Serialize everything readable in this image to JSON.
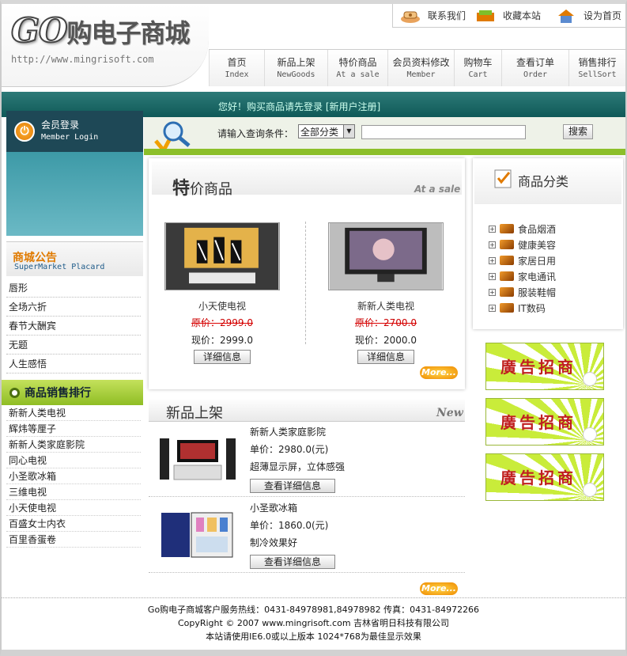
{
  "brand": {
    "logo_prefix": "GO",
    "logo_text": "购电子商城",
    "url": "http://www.mingrisoft.com"
  },
  "top_links": [
    {
      "label": "联系我们",
      "icon": "phone-icon"
    },
    {
      "label": "收藏本站",
      "icon": "bookmark-icon"
    },
    {
      "label": "设为首页",
      "icon": "home-icon"
    }
  ],
  "nav": [
    {
      "cn": "首页",
      "en": "Index"
    },
    {
      "cn": "新品上架",
      "en": "NewGoods"
    },
    {
      "cn": "特价商品",
      "en": "At a sale"
    },
    {
      "cn": "会员资料修改",
      "en": "Member"
    },
    {
      "cn": "购物车",
      "en": "Cart"
    },
    {
      "cn": "查看订单",
      "en": "Order"
    },
    {
      "cn": "销售排行",
      "en": "SellSort"
    }
  ],
  "welcome": "您好！购买商品请先登录 [新用户注册]",
  "login": {
    "title": "会员登录",
    "subtitle": "Member Login"
  },
  "search": {
    "label": "请输入查询条件：",
    "category": "全部分类",
    "button": "搜索",
    "value": ""
  },
  "placard": {
    "title": "商城公告",
    "subtitle": "SuperMarket Placard",
    "items": [
      "唇形",
      "全场六折",
      "春节大酬宾",
      "无题",
      "人生感悟"
    ]
  },
  "ranking": {
    "title": "商品销售排行",
    "items": [
      "新新人类电视",
      "辉炜等厘子",
      "新新人类家庭影院",
      "同心电视",
      "小圣歌冰箱",
      "三维电视",
      "小天使电视",
      "百盛女士内衣",
      "百里香蛋卷"
    ]
  },
  "sale": {
    "title_bold": "特",
    "title_rest": "价商品",
    "title_en": "At a sale",
    "products": [
      {
        "name": "小天使电视",
        "old_label": "原价：",
        "old_price": "2999.0",
        "now_label": "现价：",
        "now_price": "2999.0",
        "button": "详细信息"
      },
      {
        "name": "新新人类电视",
        "old_label": "原价：",
        "old_price": "2700.0",
        "now_label": "现价：",
        "now_price": "2000.0",
        "button": "详细信息"
      }
    ],
    "more": "More..."
  },
  "new_goods": {
    "title": "新品上架",
    "title_en": "New",
    "items": [
      {
        "name": "新新人类家庭影院",
        "price": "单价：2980.0(元)",
        "desc": "超薄显示屏，立体感强",
        "button": "查看详细信息"
      },
      {
        "name": "小圣歌冰箱",
        "price": "单价：1860.0(元)",
        "desc": "制冷效果好",
        "button": "查看详细信息"
      }
    ],
    "more": "More..."
  },
  "categories": {
    "title": "商品分类",
    "items": [
      "食品烟酒",
      "健康美容",
      "家居日用",
      "家电通讯",
      "服装鞋帽",
      "IT数码"
    ]
  },
  "ads": [
    "廣告招商",
    "廣告招商",
    "廣告招商"
  ],
  "footer": [
    "Go购电子商城客户服务热线：0431-84978981,84978982 传真：0431-84972266",
    "CopyRight © 2007 www.mingrisoft.com 吉林省明日科技有限公司",
    "本站请使用IE6.0或以上版本 1024*768为最佳显示效果"
  ]
}
